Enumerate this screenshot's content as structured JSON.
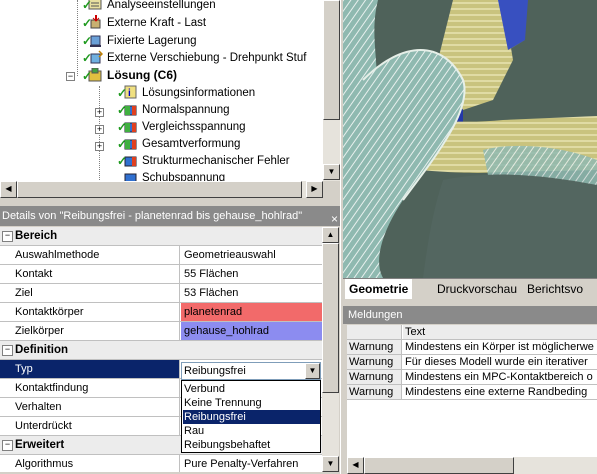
{
  "tree": {
    "items": [
      {
        "label": "Analyseeinstellungen"
      },
      {
        "label": "Externe Kraft - Last"
      },
      {
        "label": "Fixierte Lagerung"
      },
      {
        "label": "Externe Verschiebung - Drehpunkt Stuf"
      },
      {
        "label": "Lösung (C6)"
      },
      {
        "label": "Lösungsinformationen"
      },
      {
        "label": "Normalspannung"
      },
      {
        "label": "Vergleichsspannung"
      },
      {
        "label": "Gesamtverformung"
      },
      {
        "label": "Strukturmechanischer Fehler"
      },
      {
        "label": "Schubspannung"
      }
    ]
  },
  "details": {
    "title": "Details von \"Reibungsfrei - planetenrad bis gehause_hohlrad\"",
    "close_glyph": "×",
    "groups": {
      "bereich": "Bereich",
      "definition": "Definition",
      "erweitert": "Erweitert"
    },
    "rows": {
      "auswahlmethode": {
        "key": "Auswahlmethode",
        "value": "Geometrieauswahl"
      },
      "kontakt": {
        "key": "Kontakt",
        "value": "55 Flächen"
      },
      "ziel": {
        "key": "Ziel",
        "value": "53 Flächen"
      },
      "kontaktkoerper": {
        "key": "Kontaktkörper",
        "value": "planetenrad"
      },
      "zielkoerper": {
        "key": "Zielkörper",
        "value": "gehause_hohlrad"
      },
      "typ": {
        "key": "Typ",
        "value": "Reibungsfrei"
      },
      "kontaktfindung": {
        "key": "Kontaktfindung",
        "value": ""
      },
      "verhalten": {
        "key": "Verhalten",
        "value": ""
      },
      "unterdrueckt": {
        "key": "Unterdrückt",
        "value": ""
      },
      "algorithmus": {
        "key": "Algorithmus",
        "value": "Pure Penalty-Verfahren"
      }
    },
    "colors": {
      "kontaktkoerper": "#f26a6a",
      "zielkoerper": "#8c8cf0"
    },
    "dropdown": {
      "options": [
        "Verbund",
        "Keine Trennung",
        "Reibungsfrei",
        "Rau",
        "Reibungsbehaftet"
      ],
      "selected": "Reibungsfrei"
    }
  },
  "tabs": [
    {
      "label": "Geometrie",
      "active": true
    },
    {
      "label": "Druckvorschau",
      "active": false
    },
    {
      "label": "Berichtsvo",
      "active": false
    }
  ],
  "messages": {
    "title": "Meldungen",
    "header": {
      "col1": "",
      "col2": "Text"
    },
    "rows": [
      {
        "type": "Warnung",
        "text": "Mindestens ein Körper ist möglicherwe"
      },
      {
        "type": "Warnung",
        "text": "Für dieses Modell wurde ein iterativer"
      },
      {
        "type": "Warnung",
        "text": "Mindestens ein MPC-Kontaktbereich o"
      },
      {
        "type": "Warnung",
        "text": "Mindestens eine externe Randbeding"
      }
    ]
  }
}
